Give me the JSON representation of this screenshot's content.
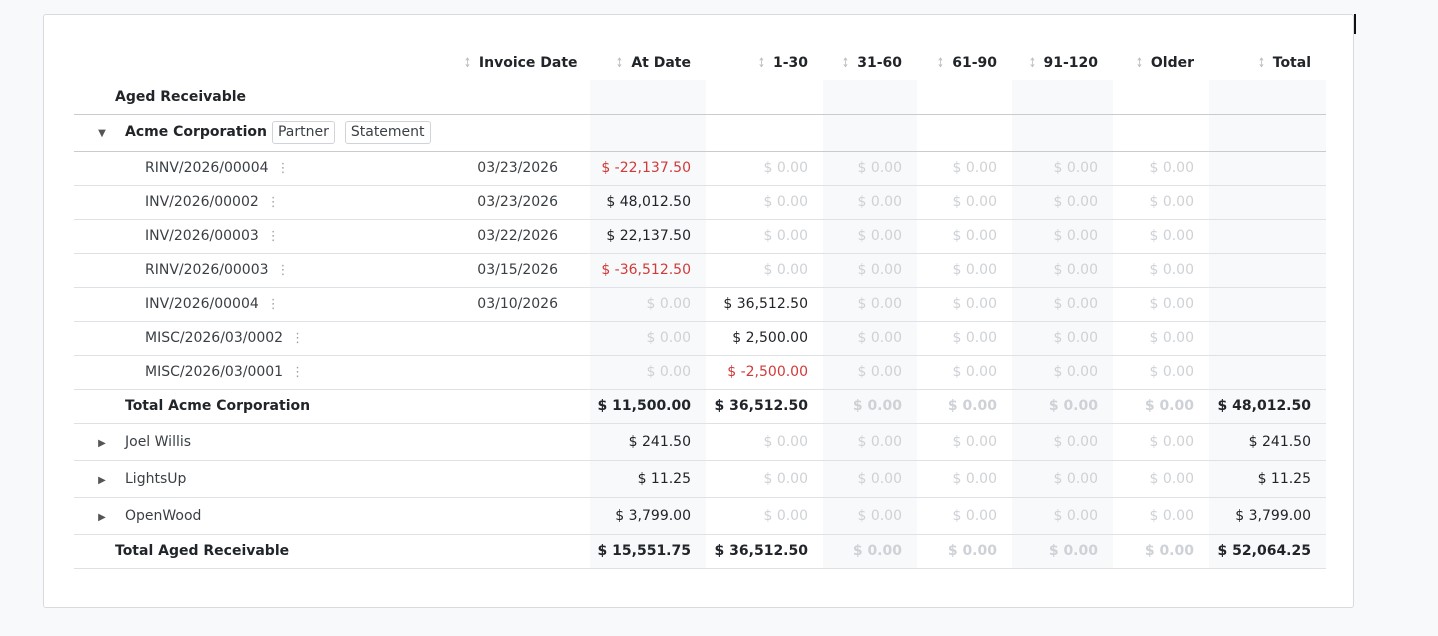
{
  "columns": [
    "Invoice Date",
    "At Date",
    "1-30",
    "31-60",
    "61-90",
    "91-120",
    "Older",
    "Total"
  ],
  "report": {
    "title": "Aged Receivable"
  },
  "group": {
    "name": "Acme Corporation",
    "buttons": {
      "partner": "Partner",
      "statement": "Statement"
    },
    "lines": [
      {
        "ref": "RINV/2026/00004",
        "date": "03/23/2026",
        "values": [
          "$ -22,137.50",
          "$ 0.00",
          "$ 0.00",
          "$ 0.00",
          "$ 0.00",
          "$ 0.00"
        ],
        "total": ""
      },
      {
        "ref": "INV/2026/00002",
        "date": "03/23/2026",
        "values": [
          "$ 48,012.50",
          "$ 0.00",
          "$ 0.00",
          "$ 0.00",
          "$ 0.00",
          "$ 0.00"
        ],
        "total": ""
      },
      {
        "ref": "INV/2026/00003",
        "date": "03/22/2026",
        "values": [
          "$ 22,137.50",
          "$ 0.00",
          "$ 0.00",
          "$ 0.00",
          "$ 0.00",
          "$ 0.00"
        ],
        "total": ""
      },
      {
        "ref": "RINV/2026/00003",
        "date": "03/15/2026",
        "values": [
          "$ -36,512.50",
          "$ 0.00",
          "$ 0.00",
          "$ 0.00",
          "$ 0.00",
          "$ 0.00"
        ],
        "total": ""
      },
      {
        "ref": "INV/2026/00004",
        "date": "03/10/2026",
        "values": [
          "$ 0.00",
          "$ 36,512.50",
          "$ 0.00",
          "$ 0.00",
          "$ 0.00",
          "$ 0.00"
        ],
        "total": ""
      },
      {
        "ref": "MISC/2026/03/0002",
        "date": "",
        "values": [
          "$ 0.00",
          "$ 2,500.00",
          "$ 0.00",
          "$ 0.00",
          "$ 0.00",
          "$ 0.00"
        ],
        "total": ""
      },
      {
        "ref": "MISC/2026/03/0001",
        "date": "",
        "values": [
          "$ 0.00",
          "$ -2,500.00",
          "$ 0.00",
          "$ 0.00",
          "$ 0.00",
          "$ 0.00"
        ],
        "total": ""
      }
    ],
    "total": {
      "label": "Total Acme Corporation",
      "values": [
        "$ 11,500.00",
        "$ 36,512.50",
        "$ 0.00",
        "$ 0.00",
        "$ 0.00",
        "$ 0.00"
      ],
      "total": "$ 48,012.50"
    }
  },
  "partners": [
    {
      "name": "Joel Willis",
      "values": [
        "$ 241.50",
        "$ 0.00",
        "$ 0.00",
        "$ 0.00",
        "$ 0.00",
        "$ 0.00"
      ],
      "total": "$ 241.50"
    },
    {
      "name": "LightsUp",
      "values": [
        "$ 11.25",
        "$ 0.00",
        "$ 0.00",
        "$ 0.00",
        "$ 0.00",
        "$ 0.00"
      ],
      "total": "$ 11.25"
    },
    {
      "name": "OpenWood",
      "values": [
        "$ 3,799.00",
        "$ 0.00",
        "$ 0.00",
        "$ 0.00",
        "$ 0.00",
        "$ 0.00"
      ],
      "total": "$ 3,799.00"
    }
  ],
  "grand_total": {
    "label": "Total Aged Receivable",
    "values": [
      "$ 15,551.75",
      "$ 36,512.50",
      "$ 0.00",
      "$ 0.00",
      "$ 0.00",
      "$ 0.00"
    ],
    "total": "$ 52,064.25"
  },
  "colors": {
    "negative": "#d13a3a",
    "muted": "#ced2d6",
    "shade": "#f8f9fa"
  },
  "icons": {
    "sort": "sort-arrows-icon",
    "expanded": "caret-down-icon",
    "collapsed": "caret-right-icon",
    "menu": "kebab-menu-icon"
  }
}
